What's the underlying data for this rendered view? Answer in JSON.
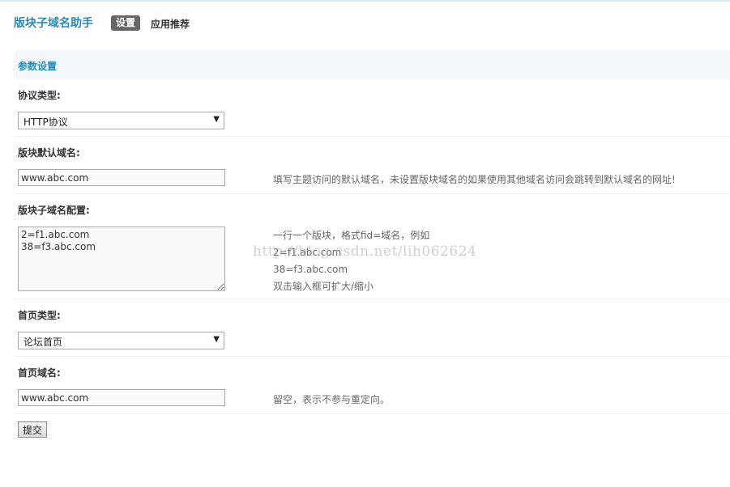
{
  "header": {
    "app_title": "版块子域名助手",
    "tabs": [
      {
        "label": "设置",
        "active": true
      },
      {
        "label": "应用推荐",
        "active": false
      }
    ]
  },
  "section": {
    "title": "参数设置"
  },
  "form": {
    "protocol": {
      "label": "协议类型:",
      "selected": "HTTP协议"
    },
    "default_domain": {
      "label": "版块默认域名:",
      "value": "www.abc.com",
      "help": "填写主题访问的默认域名，未设置版块域名的如果使用其他域名访问会跳转到默认域名的网址!"
    },
    "subdomain_config": {
      "label": "版块子域名配置:",
      "value": "2=f1.abc.com\n38=f3.abc.com",
      "help_lines": [
        "一行一个版块，格式fid=域名，例如",
        "2=f1.abc.com",
        "38=f3.abc.com",
        "双击输入框可扩大/缩小"
      ]
    },
    "homepage_type": {
      "label": "首页类型:",
      "selected": "论坛首页"
    },
    "homepage_domain": {
      "label": "首页域名:",
      "value": "www.abc.com",
      "help": "留空，表示不参与重定向。"
    },
    "submit_label": "提交"
  },
  "watermark": "http://blog.csdn.net/lih062624",
  "colors": {
    "accent": "#2b8ab3",
    "section_bg": "#f2f7fb",
    "active_tab_bg": "#666666"
  }
}
